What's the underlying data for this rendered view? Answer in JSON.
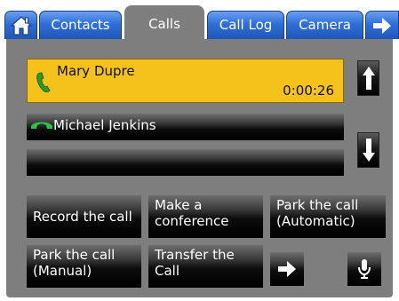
{
  "tabs": {
    "home_icon": "home-icon",
    "contacts": "Contacts",
    "calls": "Calls",
    "call_log": "Call Log",
    "camera": "Camera",
    "more_icon": "arrow-right-icon"
  },
  "active_call": {
    "name": "Mary Dupre",
    "duration": "0:00:26",
    "color": "#f4c21a"
  },
  "call_list": [
    {
      "name": "Michael Jenkins"
    },
    {
      "name": ""
    }
  ],
  "actions": {
    "record": "Record the call",
    "conference": "Make a\nconference",
    "park_auto": "Park the call\n(Automatic)",
    "park_manual": "Park the call\n(Manual)",
    "transfer": "Transfer the\nCall"
  },
  "icons": {
    "scroll_up": "arrow-up-icon",
    "scroll_down": "arrow-down-icon",
    "next_page": "arrow-right-icon",
    "microphone": "microphone-icon"
  },
  "colors": {
    "tab_blue": "#2f6fd9",
    "panel_gray": "#7e7e7e",
    "held_call_icon": "#2fbf4a"
  }
}
